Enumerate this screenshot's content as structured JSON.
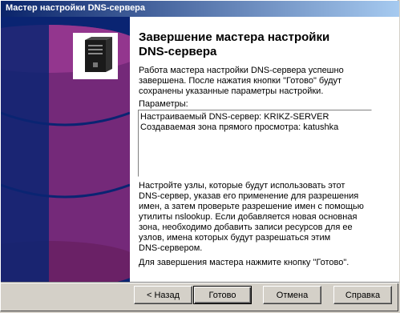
{
  "window": {
    "title": "Мастер настройки DNS-сервера"
  },
  "content": {
    "heading_line1": "Завершение мастера настройки",
    "heading_line2": "DNS-сервера",
    "intro_line1": "Работа мастера настройки DNS-сервера успешно",
    "intro_line2": "завершена. После нажатия кнопки \"Готово\" будут",
    "intro_line3": "сохранены указанные параметры настройки.",
    "params_label": "Параметры:",
    "params": [
      "Настраиваемый DNS-сервер: KRIKZ-SERVER",
      "Создаваемая зона прямого просмотра: katushka"
    ],
    "notes_lines": [
      "Настройте узлы, которые будут использовать этот",
      "DNS-сервер, указав его применение для разрешения",
      "имен, а затем проверьте разрешение имен с помощью",
      "утилиты nslookup. Если добавляется новая основная",
      "зона, необходимо добавить записи ресурсов для ее",
      "узлов, имена которых будут разрешаться этим",
      "DNS-сервером."
    ],
    "finish_note": "Для завершения мастера нажмите кнопку \"Готово\"."
  },
  "buttons": {
    "back": "< Назад",
    "finish": "Готово",
    "cancel": "Отмена",
    "help": "Справка"
  },
  "colors": {
    "left_panel": "#0a2472",
    "title_start": "#0a246a",
    "title_end": "#a6caf0"
  },
  "icons": {
    "logo": "server-icon"
  }
}
